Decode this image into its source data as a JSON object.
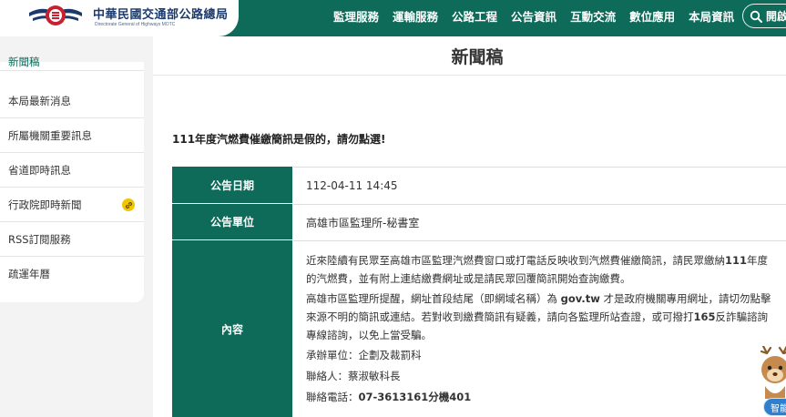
{
  "header": {
    "logo_title": "中華民國交通部公路總局",
    "logo_subtitle": "Directorate General of Highways MOTC",
    "nav": [
      "監理服務",
      "運輸服務",
      "公路工程",
      "公告資訊",
      "互動交流",
      "數位應用",
      "本局資訊"
    ],
    "search_label": "開啟"
  },
  "sidebar": {
    "items": [
      {
        "label": "新聞稿"
      },
      {
        "label": "本局最新消息"
      },
      {
        "label": "所屬機關重要訊息"
      },
      {
        "label": "省道即時訊息"
      },
      {
        "label": "行政院即時新聞"
      },
      {
        "label": "RSS訂閱服務"
      },
      {
        "label": "疏運年曆"
      }
    ]
  },
  "main": {
    "page_title": "新聞稿",
    "headline": "111年度汽燃費催繳簡訊是假的，請勿點選!",
    "table": {
      "date_label": "公告日期",
      "date_value": "112-04-11 14:45",
      "unit_label": "公告單位",
      "unit_value": "高雄市區監理所-秘書室",
      "content_label": "內容",
      "para1_a": "近來陸續有民眾至高雄市區監理汽燃費窗口或打電話反映收到汽燃費催繳簡訊，請民眾繳納",
      "para1_bold": "111",
      "para1_b": "年度的汽燃費，並有附上連結繳費網址或是請民眾回覆簡訊開始查詢繳費。",
      "para2_a": "高雄市區監理所提醒，網址首段結尾（即網域名稱）為 ",
      "para2_bold1": "gov.tw",
      "para2_b": " 才是政府機關專用網址，請切勿點擊來源不明的簡訊或連結。若對收到繳費簡訊有疑義，請向各監理所站查證，或可撥打",
      "para2_bold2": "165",
      "para2_c": "反詐騙諮詢專線諮詢，以免上當受騙。",
      "contact_unit": "承辦單位：企劃及裁罰科",
      "contact_person": "聯絡人：蔡淑敏科長",
      "contact_phone_label": "聯絡電話：",
      "contact_phone": "07-3613161分機401"
    }
  },
  "widget": {
    "chat_label": "智能"
  },
  "colors": {
    "brand_green": "#0e6b5a",
    "badge_yellow": "#f2c500",
    "chat_blue": "#2f7fcf"
  }
}
